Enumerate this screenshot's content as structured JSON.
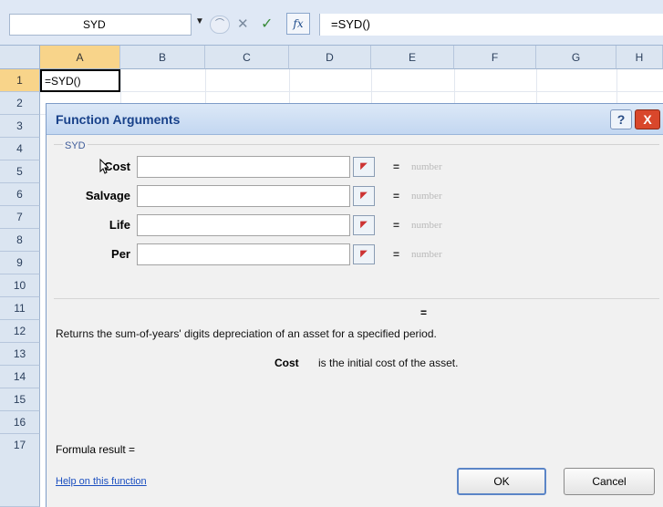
{
  "formula_bar": {
    "name_box": "SYD",
    "dropdown_icon": "triangle-down",
    "formula": "=SYD()",
    "fx_label": "fx"
  },
  "columns": [
    "A",
    "B",
    "C",
    "D",
    "E",
    "F",
    "G",
    "H"
  ],
  "rows": [
    "1",
    "2",
    "3",
    "4",
    "5",
    "6",
    "7",
    "8",
    "9",
    "10",
    "11",
    "12",
    "13",
    "14",
    "15",
    "16",
    "17"
  ],
  "cell_a1": "=SYD()",
  "dialog": {
    "title": "Function Arguments",
    "help_label": "?",
    "close_label": "X",
    "function_name": "SYD",
    "args": [
      {
        "label": "Cost",
        "value": "",
        "eq": "=",
        "type": "number"
      },
      {
        "label": "Salvage",
        "value": "",
        "eq": "=",
        "type": "number"
      },
      {
        "label": "Life",
        "value": "",
        "eq": "=",
        "type": "number"
      },
      {
        "label": "Per",
        "value": "",
        "eq": "=",
        "type": "number"
      }
    ],
    "result_eq": "=",
    "description": "Returns the sum-of-years' digits depreciation of an asset for a specified period.",
    "arg_help_name": "Cost",
    "arg_help_text": "is the initial cost of the asset.",
    "formula_result_label": "Formula result =",
    "help_link": "Help on this function",
    "ok_label": "OK",
    "cancel_label": "Cancel"
  },
  "colors": {
    "title_text": "#18418a",
    "active_header": "#f8d48a",
    "close_button": "#d9472b",
    "link": "#1b4fc0"
  }
}
